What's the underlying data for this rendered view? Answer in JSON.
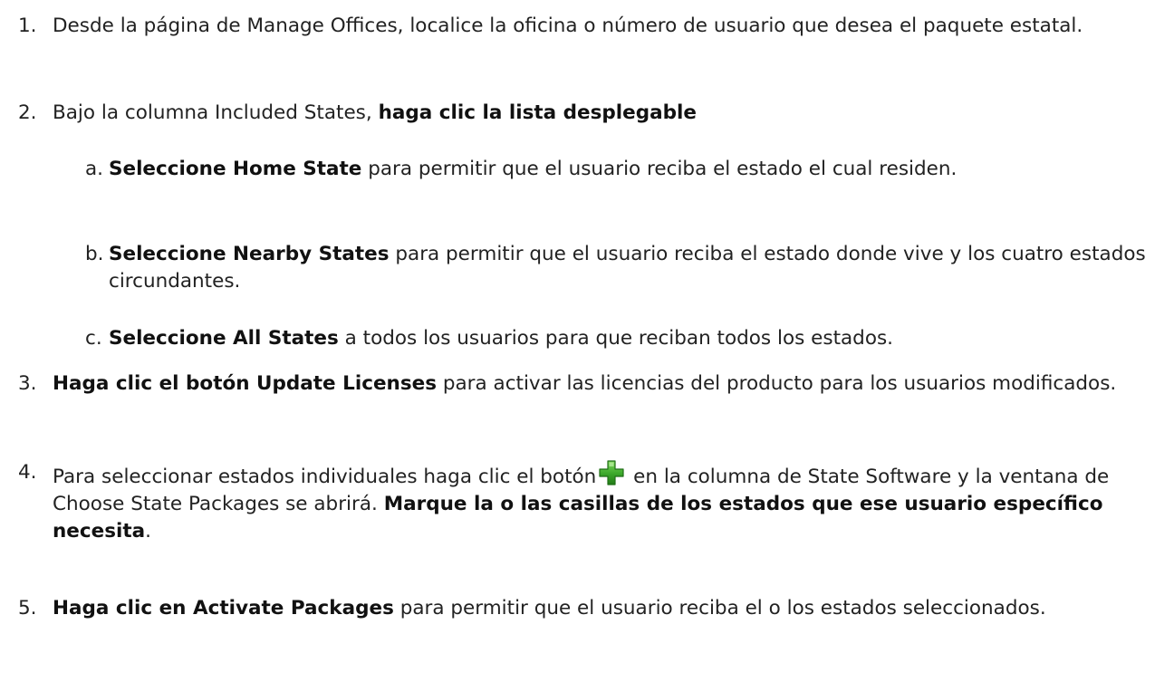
{
  "steps": [
    {
      "number": "1.",
      "text": "Desde la página de Manage Offices, localice la oficina o número de usuario que desea el paquete estatal."
    },
    {
      "number": "2.",
      "text": "Bajo la columna Included States, ",
      "bold": "haga clic la lista desplegable",
      "substeps": [
        {
          "letter": "a.",
          "bold": "Seleccione Home State",
          "text": " para permitir que el usuario reciba el estado el cual residen."
        },
        {
          "letter": "b.",
          "bold": "Seleccione Nearby States",
          "text": " para permitir que el usuario reciba el estado donde vive y los cuatro estados circundantes."
        },
        {
          "letter": "c.",
          "bold": "Seleccione All States",
          "text": " a todos los usuarios para que reciban todos los estados."
        }
      ]
    },
    {
      "number": "3.",
      "bold": "Haga clic el botón Update Licenses",
      "text": " para activar las licencias del producto para los usuarios modificados."
    },
    {
      "number": "4.",
      "text_before_icon": "Para seleccionar estados individuales haga clic el botón",
      "icon": "green-plus-icon",
      "text_after_icon": " en la columna de State Software y la ventana de Choose State Packages se abrirá. ",
      "bold": "Marque la o las casillas de los estados que ese usuario específico necesita",
      "text_end": "."
    },
    {
      "number": "5.",
      "bold": "Haga clic en Activate Packages",
      "text": " para permitir que el usuario reciba el o los estados seleccionados."
    }
  ],
  "colors": {
    "text": "#222222",
    "icon_green": "#3aa72a"
  }
}
